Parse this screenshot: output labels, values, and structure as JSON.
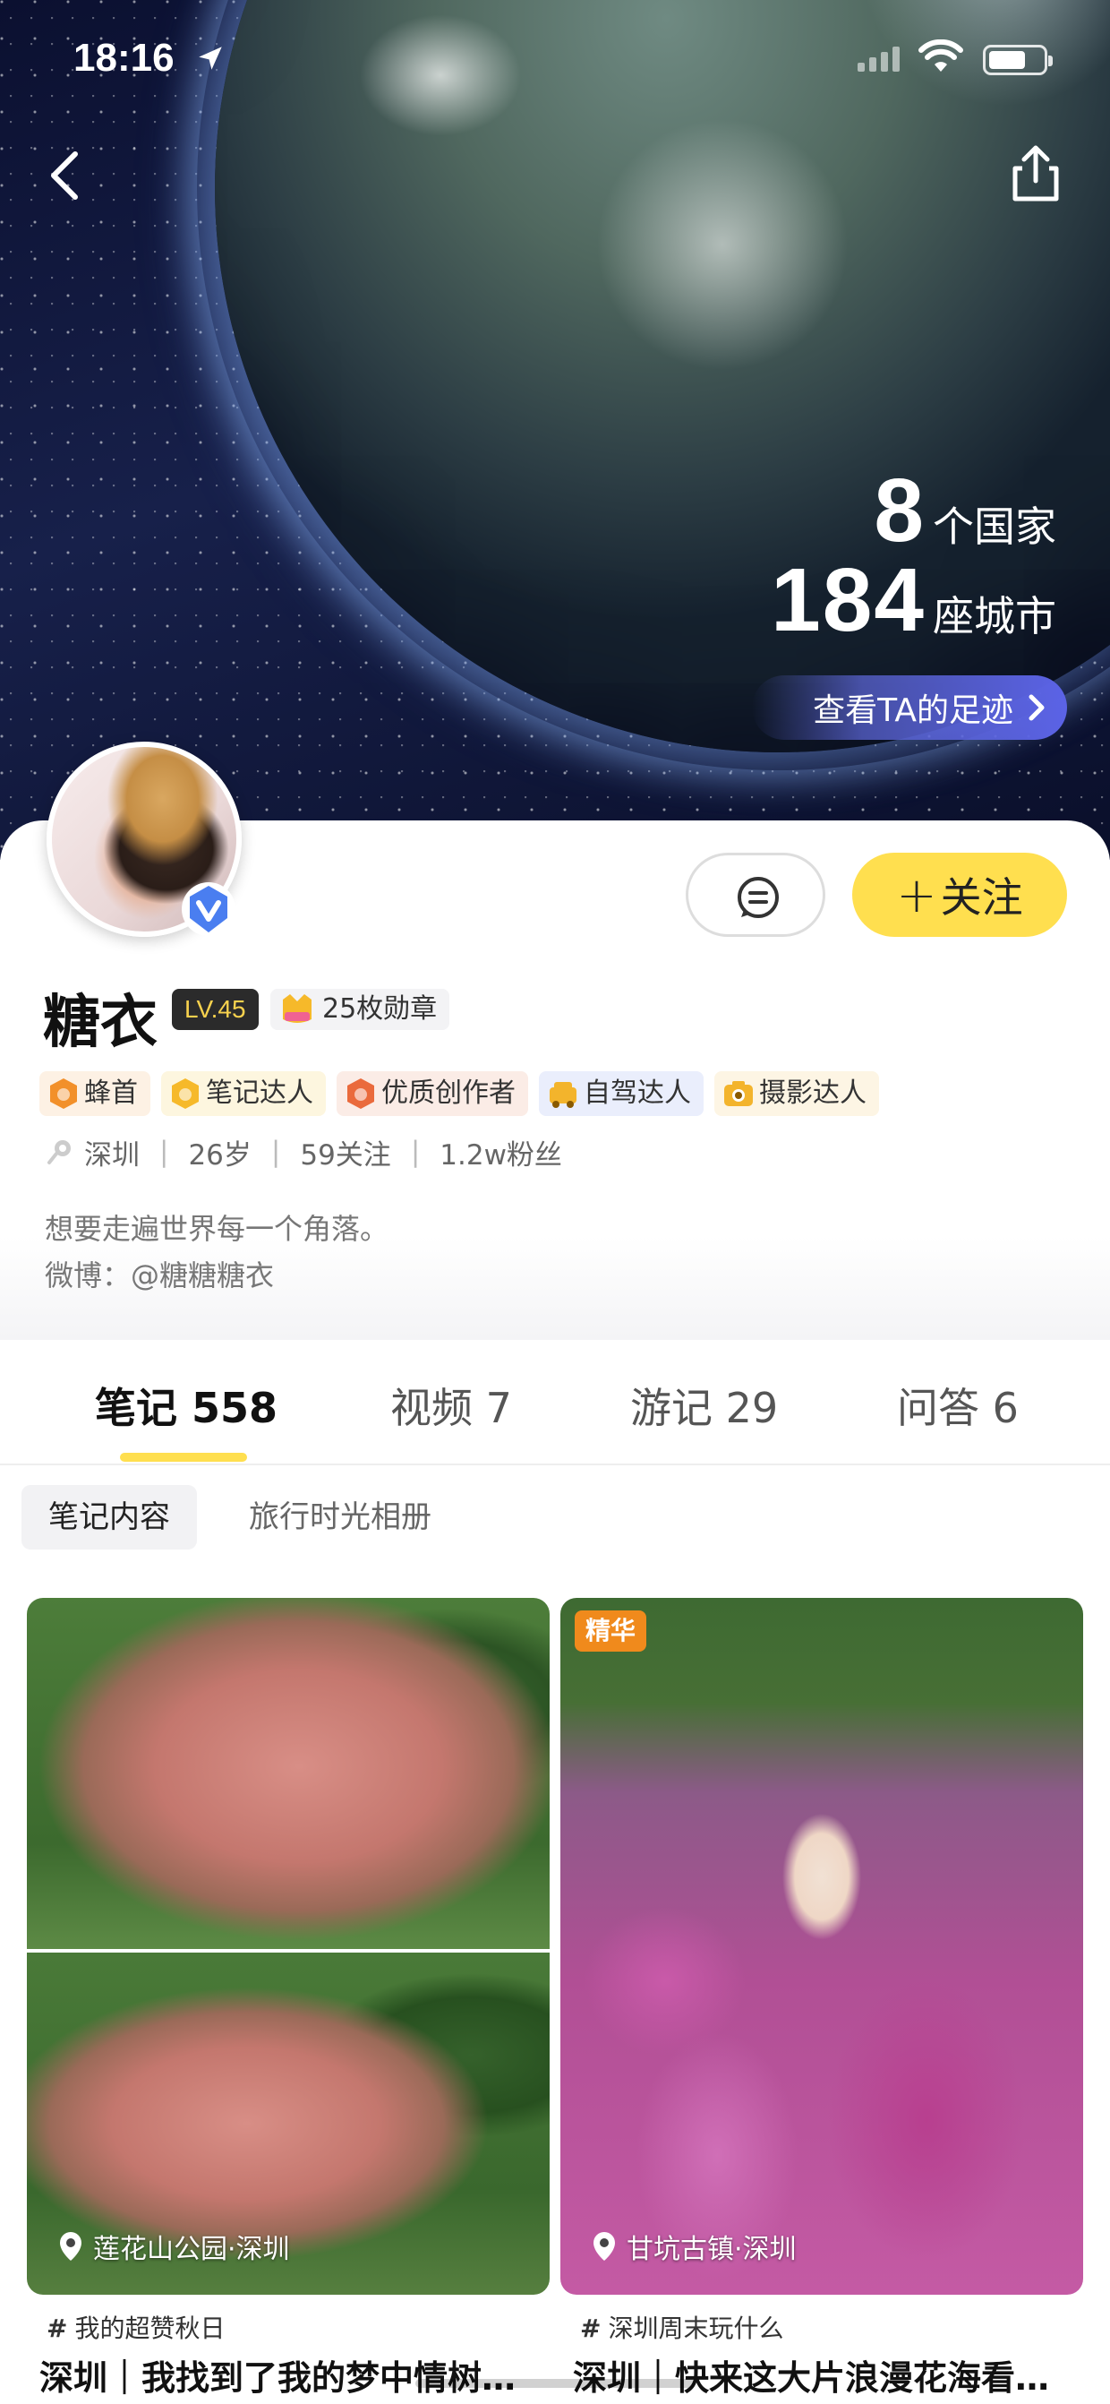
{
  "status_bar": {
    "time": "18:16",
    "battery_level": 0.6
  },
  "hero": {
    "countries_count": "8",
    "countries_unit": "个国家",
    "cities_count": "184",
    "cities_unit": "座城市",
    "footprint_label": "查看TA的足迹"
  },
  "profile": {
    "name": "糖衣",
    "level": "LV.45",
    "medal_label": "25枚勋章",
    "follow_label": "关注",
    "badges": [
      {
        "label": "蜂首",
        "color": "#fdf1e4",
        "icon_color": "#f2902a"
      },
      {
        "label": "笔记达人",
        "color": "#fdf6df",
        "icon_color": "#f6b92a"
      },
      {
        "label": "优质创作者",
        "color": "#fbece6",
        "icon_color": "#ea6a3c"
      },
      {
        "label": "自驾达人",
        "color": "#eaeefc",
        "icon_color": "#f3b42c"
      },
      {
        "label": "摄影达人",
        "color": "#fdf5e4",
        "icon_color": "#f3b42c"
      }
    ],
    "meta": {
      "city": "深圳",
      "age": "26岁",
      "following": "59关注",
      "fans": "1.2w粉丝"
    },
    "bio_line1": "想要走遍世界每一个角落。",
    "bio_line2": "微博：@糖糖糖衣"
  },
  "tabs": [
    {
      "label": "笔记 558",
      "active": true
    },
    {
      "label": "视频 7",
      "active": false
    },
    {
      "label": "游记 29",
      "active": false
    },
    {
      "label": "问答 6",
      "active": false
    }
  ],
  "subtabs": [
    {
      "label": "笔记内容",
      "active": true
    },
    {
      "label": "旅行时光相册",
      "active": false
    }
  ],
  "feed": [
    {
      "poi": "莲花山公园·深圳",
      "topic": "我的超赞秋日",
      "title": "深圳｜我找到了我的梦中情树…"
    },
    {
      "tag": "精华",
      "poi": "甘坑古镇·深圳",
      "topic": "深圳周末玩什么",
      "title": "深圳｜快来这大片浪漫花海看…"
    }
  ],
  "colors": {
    "accent_yellow": "#ffdf4f",
    "essence_orange": "#f08a1c",
    "footprint_blue": "#5b63e6"
  }
}
